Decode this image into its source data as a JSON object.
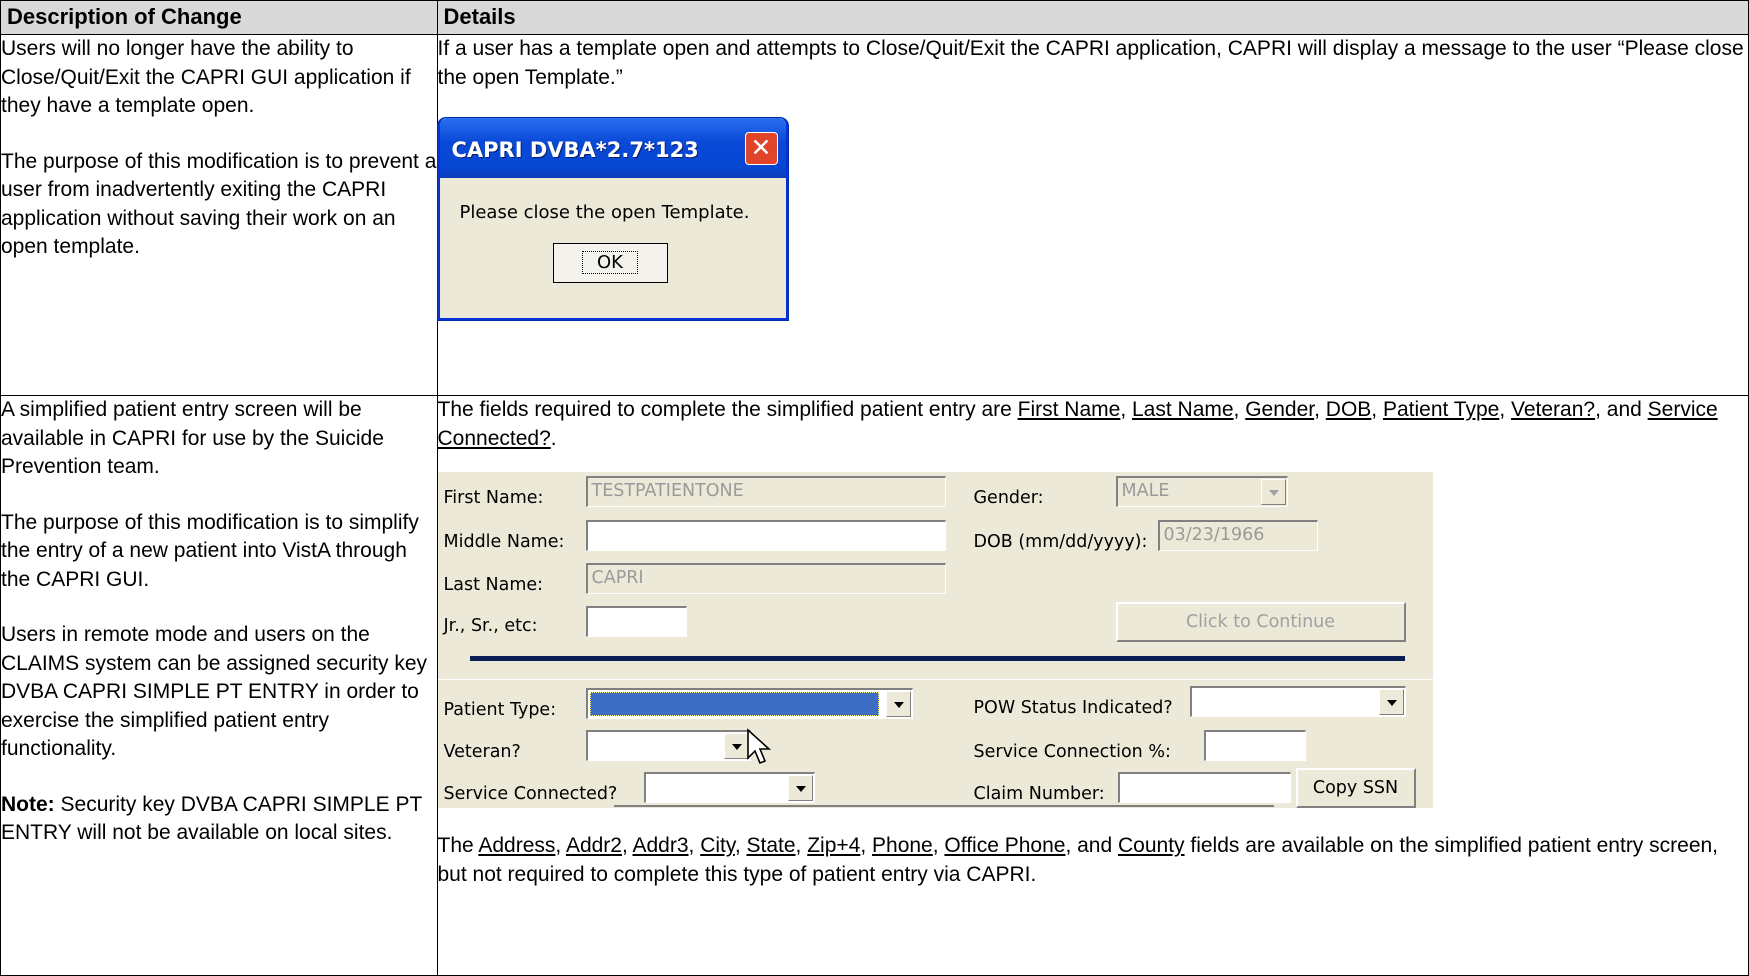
{
  "table": {
    "header": {
      "col1": "Description of Change",
      "col2": "Details"
    },
    "row1": {
      "desc_p1": "Users will no longer have the ability to Close/Quit/Exit the CAPRI GUI application if they have a template open.",
      "desc_p2": "The purpose of this modification is to prevent a user from inadvertently exiting the CAPRI application without saving their work on an open template.",
      "details_text": "If a user has a template open and attempts to Close/Quit/Exit the CAPRI application, CAPRI will display a message to the user “Please close the open Template.”",
      "dialog": {
        "title": "CAPRI DVBA*2.7*123",
        "close_glyph": "✕",
        "message": "Please close the open Template.",
        "ok_label": "OK"
      }
    },
    "row2": {
      "desc_p1": "A simplified patient entry screen will be available in CAPRI for use by the Suicide Prevention team.",
      "desc_p2": "The purpose of this modification is to simplify the entry of a new patient into VistA through the CAPRI GUI.",
      "desc_p3": "Users in remote mode and users on the CLAIMS system can be assigned security key DVBA CAPRI SIMPLE PT ENTRY in order to exercise the simplified patient entry functionality.",
      "note_label": "Note:",
      "note_text": " Security key DVBA CAPRI SIMPLE PT ENTRY will not be available on local sites.",
      "req_intro": "The fields required to complete the simplified patient entry are ",
      "req_fields": [
        "First Name",
        "Last Name",
        "Gender",
        "DOB",
        "Patient Type",
        "Veteran?",
        "Service Connected?"
      ],
      "form": {
        "first_name_label": "First Name:",
        "first_name_value": "TESTPATIENTONE",
        "middle_name_label": "Middle Name:",
        "middle_name_value": "",
        "last_name_label": "Last Name:",
        "last_name_value": "CAPRI",
        "suffix_label": "Jr., Sr., etc:",
        "suffix_value": "",
        "gender_label": "Gender:",
        "gender_value": "MALE",
        "dob_label": "DOB (mm/dd/yyyy):",
        "dob_value": "03/23/1966",
        "continue_label": "Click to Continue",
        "patient_type_label": "Patient Type:",
        "patient_type_value": "",
        "veteran_label": "Veteran?",
        "veteran_value": "",
        "service_connected_label": "Service Connected?",
        "service_connected_value": "",
        "pow_label": "POW Status Indicated?",
        "pow_value": "",
        "sc_percent_label": "Service Connection %:",
        "sc_percent_value": "",
        "claim_label": "Claim Number:",
        "claim_value": "",
        "copy_ssn_label": "Copy SSN"
      },
      "opt_intro": "The ",
      "opt_fields": [
        "Address",
        "Addr2",
        "Addr3",
        "City",
        "State",
        "Zip+4",
        "Phone",
        "Office Phone",
        "County"
      ],
      "opt_outro": " fields are available on the simplified patient entry screen, but not required to complete this type of patient entry via CAPRI."
    }
  }
}
